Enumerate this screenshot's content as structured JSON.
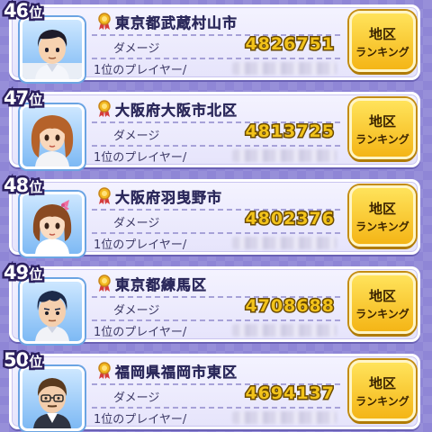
{
  "leaderboard": {
    "damage_label": "ダメージ",
    "player_label": "1位のプレイヤー/",
    "button_line1": "地区",
    "button_line2": "ランキング",
    "entries": [
      {
        "rank": "46",
        "rank_suffix": "位",
        "city": "東京都武蔵村山市",
        "damage": "4826751",
        "avatar": "boy-black-hair-icon"
      },
      {
        "rank": "47",
        "rank_suffix": "位",
        "city": "大阪府大阪市北区",
        "damage": "4813725",
        "avatar": "girl-brown-hair-icon"
      },
      {
        "rank": "48",
        "rank_suffix": "位",
        "city": "大阪府羽曳野市",
        "damage": "4802376",
        "avatar": "girl-pink-ribbon-icon"
      },
      {
        "rank": "49",
        "rank_suffix": "位",
        "city": "東京都練馬区",
        "damage": "4708688",
        "avatar": "boy-navy-hair-icon"
      },
      {
        "rank": "50",
        "rank_suffix": "位",
        "city": "福岡県福岡市東区",
        "damage": "4694137",
        "avatar": "man-glasses-icon"
      }
    ]
  }
}
